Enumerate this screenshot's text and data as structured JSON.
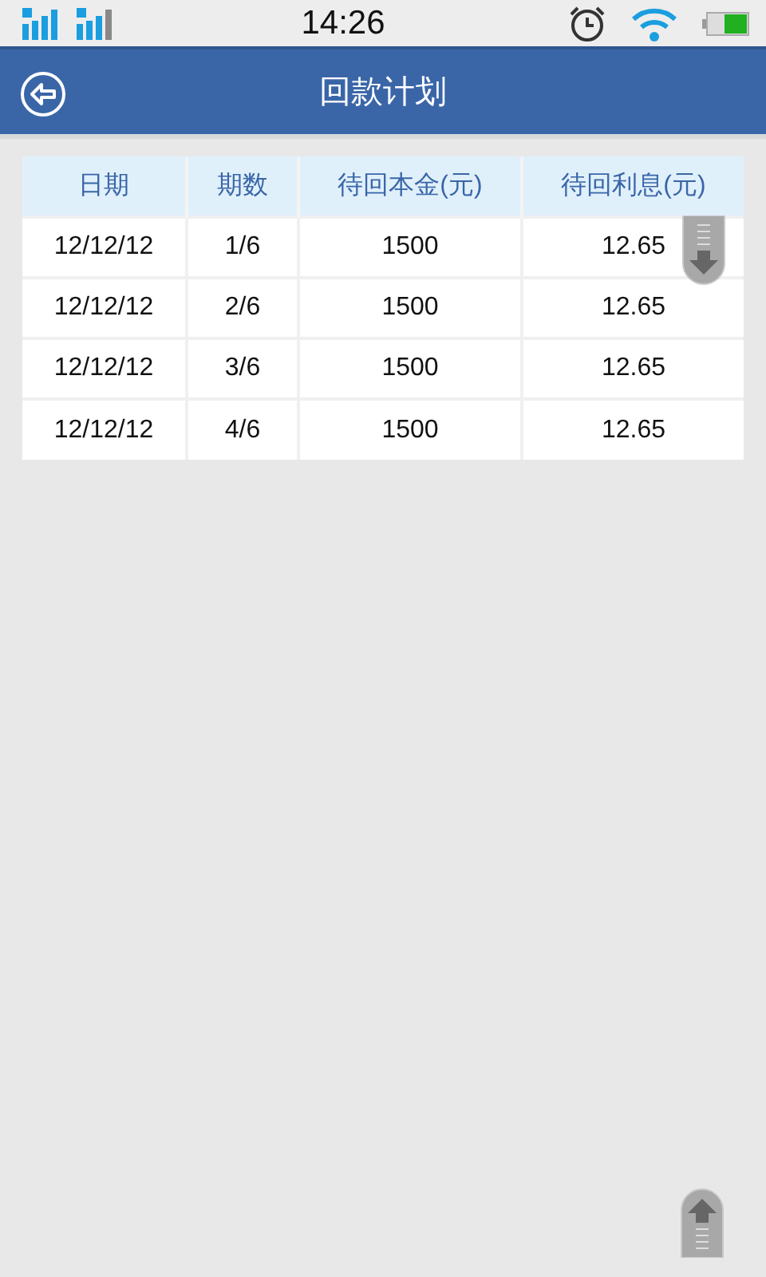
{
  "status_bar": {
    "time": "14:26"
  },
  "header": {
    "title": "回款计划"
  },
  "table": {
    "columns": [
      "日期",
      "期数",
      "待回本金(元)",
      "待回利息(元)"
    ],
    "rows": [
      [
        "12/12/12",
        "1/6",
        "1500",
        "12.65"
      ],
      [
        "12/12/12",
        "2/6",
        "1500",
        "12.65"
      ],
      [
        "12/12/12",
        "3/6",
        "1500",
        "12.65"
      ],
      [
        "12/12/12",
        "4/6",
        "1500",
        "12.65"
      ]
    ]
  }
}
